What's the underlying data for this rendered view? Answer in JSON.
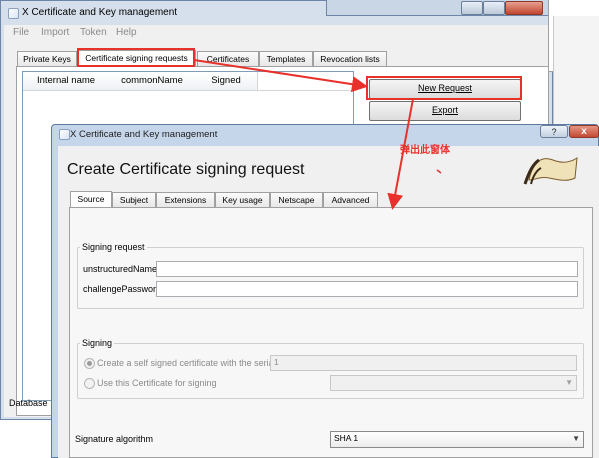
{
  "background_window": {
    "title": "X Certificate and Key management",
    "menu": [
      "File",
      "Import",
      "Token",
      "Help"
    ],
    "tabs": [
      "Private Keys",
      "Certificate signing requests",
      "Certificates",
      "Templates",
      "Revocation lists"
    ],
    "active_tab": "Certificate signing requests",
    "table_columns": [
      "Internal name",
      "commonName",
      "Signed"
    ],
    "buttons": {
      "new_request": "New Request",
      "export": "Export"
    },
    "status_label": "Database"
  },
  "dialog": {
    "title": "X Certificate and Key management",
    "help_button": "?",
    "close_button": "x",
    "heading": "Create Certificate signing request",
    "tabs": [
      "Source",
      "Subject",
      "Extensions",
      "Key usage",
      "Netscape",
      "Advanced"
    ],
    "active_tab": "Source",
    "signing_request": {
      "group_title": "Signing request",
      "fields": [
        {
          "label": "unstructuredName",
          "value": ""
        },
        {
          "label": "challengePassword",
          "value": ""
        }
      ]
    },
    "signing": {
      "group_title": "Signing",
      "option_self_signed": "Create a self signed certificate with the serial",
      "serial_value": "1",
      "option_use_certificate": "Use this Certificate for signing",
      "certificate_value": ""
    },
    "signature_algorithm": {
      "label": "Signature algorithm",
      "value": "SHA 1"
    }
  },
  "annotation": {
    "label": "弹出此窗体",
    "color": "#e8312b"
  },
  "colors": {
    "window_frame": "#c6d6ea",
    "client": "#f0f0f0",
    "annotation_red": "#e8312b"
  }
}
